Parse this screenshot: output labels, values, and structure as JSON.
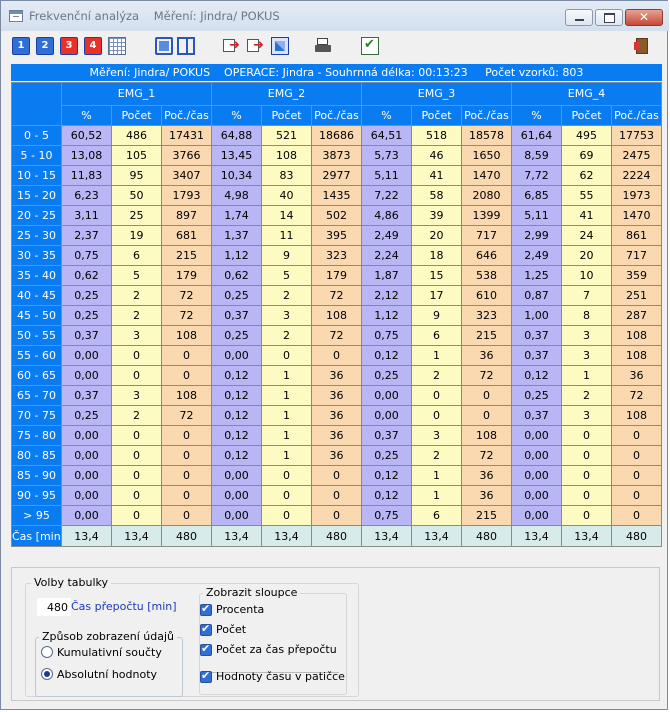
{
  "window": {
    "title": "Frekvenční analýza    Měření: Jindra/ POKUS"
  },
  "toolbar": {
    "buttons": [
      {
        "name": "view-1-button",
        "label": "1"
      },
      {
        "name": "view-2-button",
        "label": "2"
      },
      {
        "name": "view-3-button",
        "label": "3"
      },
      {
        "name": "view-4-button",
        "label": "4"
      }
    ]
  },
  "info_bar": "Měření: Jindra/ POKUS    OPERACE: Jindra - Souhrnná délka: 00:13:23     Počet vzorků: 803",
  "table": {
    "groups": [
      "EMG_1",
      "EMG_2",
      "EMG_3",
      "EMG_4"
    ],
    "subcolumns": [
      "%",
      "Počet",
      "Poč./čas"
    ],
    "rows": [
      {
        "label": "0 - 5",
        "values": [
          [
            "60,52",
            "486",
            "17431"
          ],
          [
            "64,88",
            "521",
            "18686"
          ],
          [
            "64,51",
            "518",
            "18578"
          ],
          [
            "61,64",
            "495",
            "17753"
          ]
        ]
      },
      {
        "label": "5 - 10",
        "values": [
          [
            "13,08",
            "105",
            "3766"
          ],
          [
            "13,45",
            "108",
            "3873"
          ],
          [
            "5,73",
            "46",
            "1650"
          ],
          [
            "8,59",
            "69",
            "2475"
          ]
        ]
      },
      {
        "label": "10 - 15",
        "values": [
          [
            "11,83",
            "95",
            "3407"
          ],
          [
            "10,34",
            "83",
            "2977"
          ],
          [
            "5,11",
            "41",
            "1470"
          ],
          [
            "7,72",
            "62",
            "2224"
          ]
        ]
      },
      {
        "label": "15 - 20",
        "values": [
          [
            "6,23",
            "50",
            "1793"
          ],
          [
            "4,98",
            "40",
            "1435"
          ],
          [
            "7,22",
            "58",
            "2080"
          ],
          [
            "6,85",
            "55",
            "1973"
          ]
        ]
      },
      {
        "label": "20 - 25",
        "values": [
          [
            "3,11",
            "25",
            "897"
          ],
          [
            "1,74",
            "14",
            "502"
          ],
          [
            "4,86",
            "39",
            "1399"
          ],
          [
            "5,11",
            "41",
            "1470"
          ]
        ]
      },
      {
        "label": "25 - 30",
        "values": [
          [
            "2,37",
            "19",
            "681"
          ],
          [
            "1,37",
            "11",
            "395"
          ],
          [
            "2,49",
            "20",
            "717"
          ],
          [
            "2,99",
            "24",
            "861"
          ]
        ]
      },
      {
        "label": "30 - 35",
        "values": [
          [
            "0,75",
            "6",
            "215"
          ],
          [
            "1,12",
            "9",
            "323"
          ],
          [
            "2,24",
            "18",
            "646"
          ],
          [
            "2,49",
            "20",
            "717"
          ]
        ]
      },
      {
        "label": "35 - 40",
        "values": [
          [
            "0,62",
            "5",
            "179"
          ],
          [
            "0,62",
            "5",
            "179"
          ],
          [
            "1,87",
            "15",
            "538"
          ],
          [
            "1,25",
            "10",
            "359"
          ]
        ]
      },
      {
        "label": "40 - 45",
        "values": [
          [
            "0,25",
            "2",
            "72"
          ],
          [
            "0,25",
            "2",
            "72"
          ],
          [
            "2,12",
            "17",
            "610"
          ],
          [
            "0,87",
            "7",
            "251"
          ]
        ]
      },
      {
        "label": "45 - 50",
        "values": [
          [
            "0,25",
            "2",
            "72"
          ],
          [
            "0,37",
            "3",
            "108"
          ],
          [
            "1,12",
            "9",
            "323"
          ],
          [
            "1,00",
            "8",
            "287"
          ]
        ]
      },
      {
        "label": "50 - 55",
        "values": [
          [
            "0,37",
            "3",
            "108"
          ],
          [
            "0,25",
            "2",
            "72"
          ],
          [
            "0,75",
            "6",
            "215"
          ],
          [
            "0,37",
            "3",
            "108"
          ]
        ]
      },
      {
        "label": "55 - 60",
        "values": [
          [
            "0,00",
            "0",
            "0"
          ],
          [
            "0,00",
            "0",
            "0"
          ],
          [
            "0,12",
            "1",
            "36"
          ],
          [
            "0,37",
            "3",
            "108"
          ]
        ]
      },
      {
        "label": "60 - 65",
        "values": [
          [
            "0,00",
            "0",
            "0"
          ],
          [
            "0,12",
            "1",
            "36"
          ],
          [
            "0,25",
            "2",
            "72"
          ],
          [
            "0,12",
            "1",
            "36"
          ]
        ]
      },
      {
        "label": "65 - 70",
        "values": [
          [
            "0,37",
            "3",
            "108"
          ],
          [
            "0,12",
            "1",
            "36"
          ],
          [
            "0,00",
            "0",
            "0"
          ],
          [
            "0,25",
            "2",
            "72"
          ]
        ]
      },
      {
        "label": "70 - 75",
        "values": [
          [
            "0,25",
            "2",
            "72"
          ],
          [
            "0,12",
            "1",
            "36"
          ],
          [
            "0,00",
            "0",
            "0"
          ],
          [
            "0,37",
            "3",
            "108"
          ]
        ]
      },
      {
        "label": "75 - 80",
        "values": [
          [
            "0,00",
            "0",
            "0"
          ],
          [
            "0,12",
            "1",
            "36"
          ],
          [
            "0,37",
            "3",
            "108"
          ],
          [
            "0,00",
            "0",
            "0"
          ]
        ]
      },
      {
        "label": "80 - 85",
        "values": [
          [
            "0,00",
            "0",
            "0"
          ],
          [
            "0,12",
            "1",
            "36"
          ],
          [
            "0,25",
            "2",
            "72"
          ],
          [
            "0,00",
            "0",
            "0"
          ]
        ]
      },
      {
        "label": "85 - 90",
        "values": [
          [
            "0,00",
            "0",
            "0"
          ],
          [
            "0,00",
            "0",
            "0"
          ],
          [
            "0,12",
            "1",
            "36"
          ],
          [
            "0,00",
            "0",
            "0"
          ]
        ]
      },
      {
        "label": "90 - 95",
        "values": [
          [
            "0,00",
            "0",
            "0"
          ],
          [
            "0,00",
            "0",
            "0"
          ],
          [
            "0,12",
            "1",
            "36"
          ],
          [
            "0,00",
            "0",
            "0"
          ]
        ]
      },
      {
        "label": "> 95",
        "values": [
          [
            "0,00",
            "0",
            "0"
          ],
          [
            "0,00",
            "0",
            "0"
          ],
          [
            "0,75",
            "6",
            "215"
          ],
          [
            "0,00",
            "0",
            "0"
          ]
        ]
      }
    ],
    "footer": {
      "label": "Čas [min]",
      "values": [
        [
          "13,4",
          "13,4",
          "480"
        ],
        [
          "13,4",
          "13,4",
          "480"
        ],
        [
          "13,4",
          "13,4",
          "480"
        ],
        [
          "13,4",
          "13,4",
          "480"
        ]
      ]
    }
  },
  "options": {
    "volby_legend": "Volby tabulky",
    "recalc_value": "480",
    "recalc_label": "Čas přepočtu [min]",
    "zpusob_legend": "Způsob zobrazení údajů",
    "radio_cumulative": "Kumulativní součty",
    "radio_absolute": "Absolutní hodnoty",
    "selected_radio": "absolute",
    "zobrazit_legend": "Zobrazit sloupce",
    "chk_procenta": "Procenta",
    "chk_pocet": "Počet",
    "chk_pocet_cas": "Počet za čas přepočtu",
    "chk_footer": "Hodnoty času v patičce"
  },
  "colors": {
    "header_blue": "#0a7cf2",
    "pct_col": "#b8b6f5",
    "count_col": "#fdfbc1",
    "rate_col": "#fbd9b0",
    "footer_row": "#d7ecea"
  }
}
